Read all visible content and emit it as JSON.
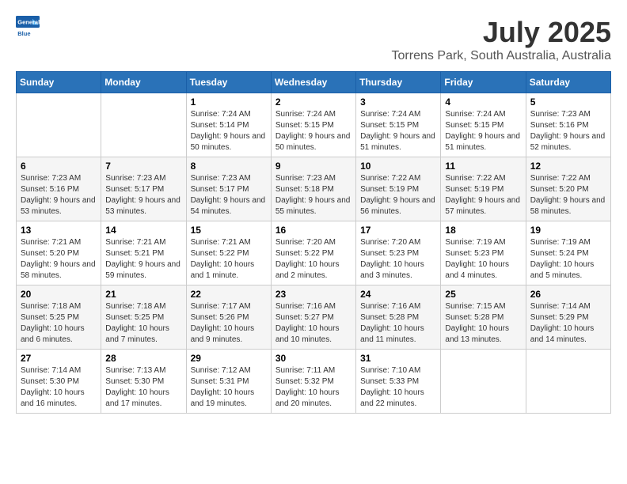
{
  "header": {
    "logo_line1": "General",
    "logo_line2": "Blue",
    "title": "July 2025",
    "subtitle": "Torrens Park, South Australia, Australia"
  },
  "days_of_week": [
    "Sunday",
    "Monday",
    "Tuesday",
    "Wednesday",
    "Thursday",
    "Friday",
    "Saturday"
  ],
  "weeks": [
    [
      {
        "day": "",
        "info": ""
      },
      {
        "day": "",
        "info": ""
      },
      {
        "day": "1",
        "info": "Sunrise: 7:24 AM\nSunset: 5:14 PM\nDaylight: 9 hours and 50 minutes."
      },
      {
        "day": "2",
        "info": "Sunrise: 7:24 AM\nSunset: 5:15 PM\nDaylight: 9 hours and 50 minutes."
      },
      {
        "day": "3",
        "info": "Sunrise: 7:24 AM\nSunset: 5:15 PM\nDaylight: 9 hours and 51 minutes."
      },
      {
        "day": "4",
        "info": "Sunrise: 7:24 AM\nSunset: 5:15 PM\nDaylight: 9 hours and 51 minutes."
      },
      {
        "day": "5",
        "info": "Sunrise: 7:23 AM\nSunset: 5:16 PM\nDaylight: 9 hours and 52 minutes."
      }
    ],
    [
      {
        "day": "6",
        "info": "Sunrise: 7:23 AM\nSunset: 5:16 PM\nDaylight: 9 hours and 53 minutes."
      },
      {
        "day": "7",
        "info": "Sunrise: 7:23 AM\nSunset: 5:17 PM\nDaylight: 9 hours and 53 minutes."
      },
      {
        "day": "8",
        "info": "Sunrise: 7:23 AM\nSunset: 5:17 PM\nDaylight: 9 hours and 54 minutes."
      },
      {
        "day": "9",
        "info": "Sunrise: 7:23 AM\nSunset: 5:18 PM\nDaylight: 9 hours and 55 minutes."
      },
      {
        "day": "10",
        "info": "Sunrise: 7:22 AM\nSunset: 5:19 PM\nDaylight: 9 hours and 56 minutes."
      },
      {
        "day": "11",
        "info": "Sunrise: 7:22 AM\nSunset: 5:19 PM\nDaylight: 9 hours and 57 minutes."
      },
      {
        "day": "12",
        "info": "Sunrise: 7:22 AM\nSunset: 5:20 PM\nDaylight: 9 hours and 58 minutes."
      }
    ],
    [
      {
        "day": "13",
        "info": "Sunrise: 7:21 AM\nSunset: 5:20 PM\nDaylight: 9 hours and 58 minutes."
      },
      {
        "day": "14",
        "info": "Sunrise: 7:21 AM\nSunset: 5:21 PM\nDaylight: 9 hours and 59 minutes."
      },
      {
        "day": "15",
        "info": "Sunrise: 7:21 AM\nSunset: 5:22 PM\nDaylight: 10 hours and 1 minute."
      },
      {
        "day": "16",
        "info": "Sunrise: 7:20 AM\nSunset: 5:22 PM\nDaylight: 10 hours and 2 minutes."
      },
      {
        "day": "17",
        "info": "Sunrise: 7:20 AM\nSunset: 5:23 PM\nDaylight: 10 hours and 3 minutes."
      },
      {
        "day": "18",
        "info": "Sunrise: 7:19 AM\nSunset: 5:23 PM\nDaylight: 10 hours and 4 minutes."
      },
      {
        "day": "19",
        "info": "Sunrise: 7:19 AM\nSunset: 5:24 PM\nDaylight: 10 hours and 5 minutes."
      }
    ],
    [
      {
        "day": "20",
        "info": "Sunrise: 7:18 AM\nSunset: 5:25 PM\nDaylight: 10 hours and 6 minutes."
      },
      {
        "day": "21",
        "info": "Sunrise: 7:18 AM\nSunset: 5:25 PM\nDaylight: 10 hours and 7 minutes."
      },
      {
        "day": "22",
        "info": "Sunrise: 7:17 AM\nSunset: 5:26 PM\nDaylight: 10 hours and 9 minutes."
      },
      {
        "day": "23",
        "info": "Sunrise: 7:16 AM\nSunset: 5:27 PM\nDaylight: 10 hours and 10 minutes."
      },
      {
        "day": "24",
        "info": "Sunrise: 7:16 AM\nSunset: 5:28 PM\nDaylight: 10 hours and 11 minutes."
      },
      {
        "day": "25",
        "info": "Sunrise: 7:15 AM\nSunset: 5:28 PM\nDaylight: 10 hours and 13 minutes."
      },
      {
        "day": "26",
        "info": "Sunrise: 7:14 AM\nSunset: 5:29 PM\nDaylight: 10 hours and 14 minutes."
      }
    ],
    [
      {
        "day": "27",
        "info": "Sunrise: 7:14 AM\nSunset: 5:30 PM\nDaylight: 10 hours and 16 minutes."
      },
      {
        "day": "28",
        "info": "Sunrise: 7:13 AM\nSunset: 5:30 PM\nDaylight: 10 hours and 17 minutes."
      },
      {
        "day": "29",
        "info": "Sunrise: 7:12 AM\nSunset: 5:31 PM\nDaylight: 10 hours and 19 minutes."
      },
      {
        "day": "30",
        "info": "Sunrise: 7:11 AM\nSunset: 5:32 PM\nDaylight: 10 hours and 20 minutes."
      },
      {
        "day": "31",
        "info": "Sunrise: 7:10 AM\nSunset: 5:33 PM\nDaylight: 10 hours and 22 minutes."
      },
      {
        "day": "",
        "info": ""
      },
      {
        "day": "",
        "info": ""
      }
    ]
  ]
}
